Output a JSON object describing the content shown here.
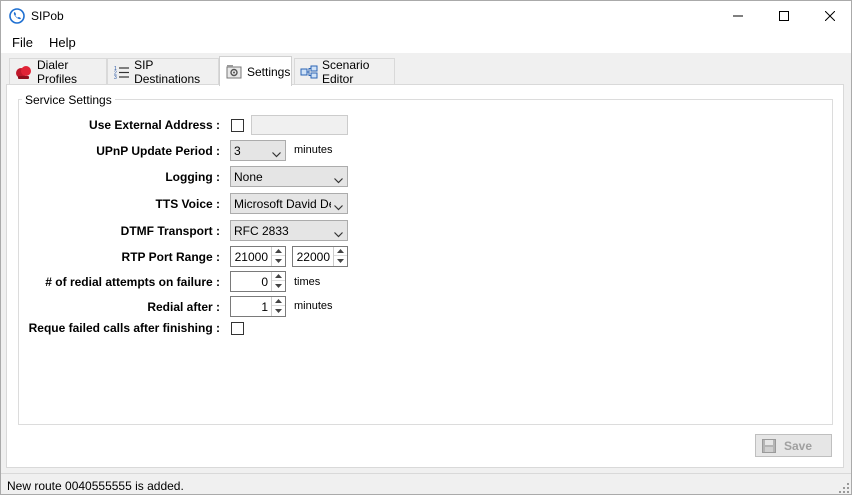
{
  "window": {
    "title": "SIPob"
  },
  "menu": {
    "file": "File",
    "help": "Help"
  },
  "tabs": [
    {
      "label": "Dialer Profiles",
      "icon": "dialer-profiles-icon"
    },
    {
      "label": "SIP Destinations",
      "icon": "list-icon"
    },
    {
      "label": "Settings",
      "icon": "settings-icon",
      "active": true
    },
    {
      "label": "Scenario Editor",
      "icon": "scenario-editor-icon"
    }
  ],
  "settings": {
    "group_title": "Service Settings",
    "use_external_address": {
      "label": "Use External Address :",
      "checked": false,
      "value": ""
    },
    "upnp_update_period": {
      "label": "UPnP Update Period :",
      "value": "3",
      "unit": "minutes"
    },
    "logging": {
      "label": "Logging :",
      "value": "None"
    },
    "tts_voice": {
      "label": "TTS Voice :",
      "value": "Microsoft David Des"
    },
    "dtmf_transport": {
      "label": "DTMF Transport :",
      "value": "RFC 2833"
    },
    "rtp_port_range": {
      "label": "RTP Port Range :",
      "from": "21000",
      "to": "22000"
    },
    "redial_attempts": {
      "label": "# of redial attempts on failure :",
      "value": "0",
      "unit": "times"
    },
    "redial_after": {
      "label": "Redial after :",
      "value": "1",
      "unit": "minutes"
    },
    "reque_failed": {
      "label": "Reque failed calls after finishing :",
      "checked": false
    }
  },
  "actions": {
    "save_label": "Save"
  },
  "status": {
    "text": "New route 0040555555 is added."
  }
}
